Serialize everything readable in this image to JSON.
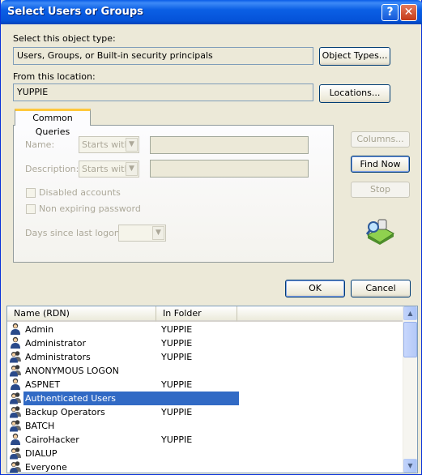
{
  "window": {
    "title": "Select Users or Groups",
    "help_glyph": "?",
    "close_glyph": "✕"
  },
  "object_type": {
    "label": "Select this object type:",
    "value": "Users, Groups, or Built-in security principals",
    "button": "Object Types..."
  },
  "location": {
    "label": "From this location:",
    "value": "YUPPIE",
    "button": "Locations..."
  },
  "queries": {
    "tab": "Common Queries",
    "name_label": "Name:",
    "name_mode": "Starts with",
    "description_label": "Description:",
    "description_mode": "Starts with",
    "disabled_accounts": "Disabled accounts",
    "non_expiring": "Non expiring password",
    "days_label": "Days since last logon:"
  },
  "side_buttons": {
    "columns": "Columns...",
    "find_now": "Find Now",
    "stop": "Stop"
  },
  "dialog_buttons": {
    "ok": "OK",
    "cancel": "Cancel"
  },
  "results": {
    "columns": [
      "Name (RDN)",
      "In Folder"
    ],
    "rows": [
      {
        "name": "Admin",
        "folder": "YUPPIE",
        "kind": "user"
      },
      {
        "name": "Administrator",
        "folder": "YUPPIE",
        "kind": "user"
      },
      {
        "name": "Administrators",
        "folder": "YUPPIE",
        "kind": "group"
      },
      {
        "name": "ANONYMOUS LOGON",
        "folder": "",
        "kind": "group"
      },
      {
        "name": "ASPNET",
        "folder": "YUPPIE",
        "kind": "user"
      },
      {
        "name": "Authenticated Users",
        "folder": "",
        "kind": "group",
        "selected": true
      },
      {
        "name": "Backup Operators",
        "folder": "YUPPIE",
        "kind": "group"
      },
      {
        "name": "BATCH",
        "folder": "",
        "kind": "group"
      },
      {
        "name": "CairoHacker",
        "folder": "YUPPIE",
        "kind": "user"
      },
      {
        "name": "DIALUP",
        "folder": "",
        "kind": "group"
      },
      {
        "name": "Everyone",
        "folder": "",
        "kind": "group"
      }
    ]
  },
  "colors": {
    "title_bar": "#0553d8",
    "selection": "#316ac5",
    "dialog_bg": "#ece9d8"
  }
}
